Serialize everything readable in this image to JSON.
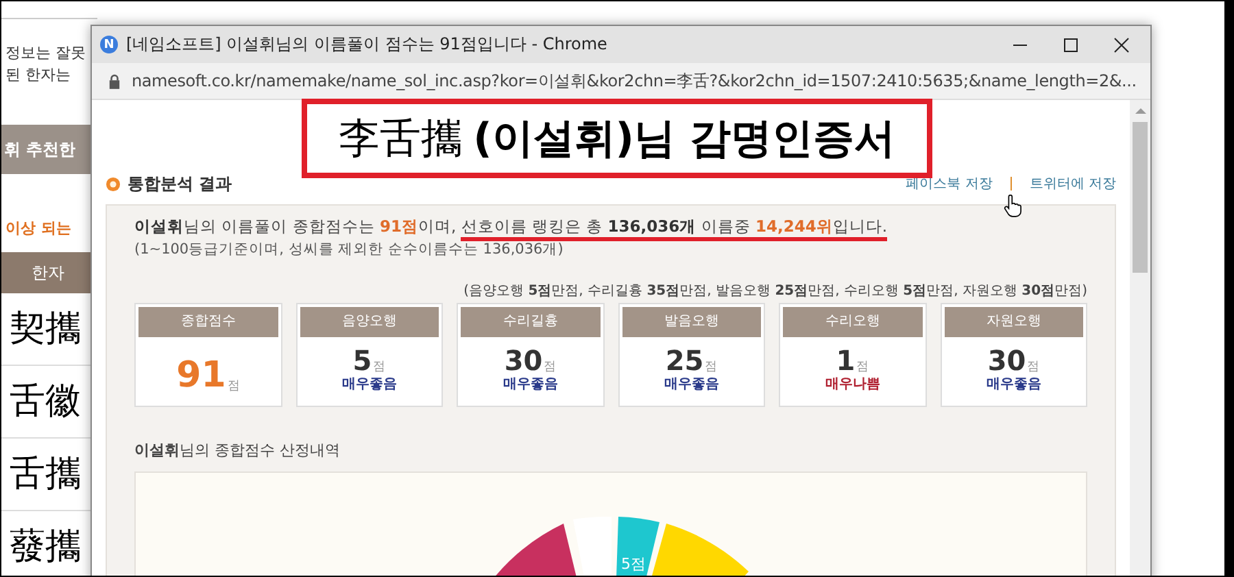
{
  "background_page": {
    "notes": [
      "정보는 잘못",
      "된 한자는"
    ],
    "tab_label": "휘 추천한",
    "warning": "이상 되는",
    "column_header": "한자",
    "hanja_rows": [
      "契攜",
      "舌徽",
      "舌攜",
      "蕟攜"
    ]
  },
  "window": {
    "favicon": "N",
    "title": "[네임소프트] 이설휘님의 이름풀이 점수는 91점입니다 - Chrome",
    "url": "namesoft.co.kr/namemake/name_sol_inc.asp?kor=이설휘&kor2chn=李舌?&kor2chn_id=1507:2410:5635;&name_length=2&..."
  },
  "certificate": {
    "hanja": "李舌攜",
    "title": "(이설휘)님 감명인증서"
  },
  "section_title": "통합분석 결과",
  "share_links": [
    "페이스북 저장",
    "트위터에 저장"
  ],
  "summary": [
    {
      "kind": "name",
      "text": "이설휘",
      "marked": false
    },
    {
      "kind": "plain",
      "text": "님의 이름풀이 종합점수는 ",
      "marked": false
    },
    {
      "kind": "accent",
      "text": "91점",
      "marked": false
    },
    {
      "kind": "plain",
      "text": "이며, ",
      "marked": false
    },
    {
      "kind": "plain",
      "text": "선호이름 랭킹은 총 ",
      "marked": true
    },
    {
      "kind": "name",
      "text": "136,036개",
      "marked": true
    },
    {
      "kind": "plain",
      "text": " 이름중 ",
      "marked": true
    },
    {
      "kind": "accent",
      "text": "14,244위",
      "marked": true
    },
    {
      "kind": "plain",
      "text": "입니다.",
      "marked": true
    }
  ],
  "summary_note": "(1~100등급기준이며, 성씨를 제외한 순수이름수는 136,036개)",
  "max_scores_note": "(음양오행 **5점**만점, 수리길흉 **35점**만점, 발음오행 **25점**만점, 수리오행 **5점**만점, 자원오행 **30점**만점)",
  "score_cards": [
    {
      "kind": "total",
      "title": "종합점수",
      "score": "91",
      "unit": "점"
    },
    {
      "kind": "good",
      "title": "음양오행",
      "score": "5",
      "unit": "점",
      "verdict": "매우좋음"
    },
    {
      "kind": "good",
      "title": "수리길흉",
      "score": "30",
      "unit": "점",
      "verdict": "매우좋음"
    },
    {
      "kind": "good",
      "title": "발음오행",
      "score": "25",
      "unit": "점",
      "verdict": "매우좋음"
    },
    {
      "kind": "bad",
      "title": "수리오행",
      "score": "1",
      "unit": "점",
      "verdict": "매우나쁨"
    },
    {
      "kind": "good",
      "title": "자원오행",
      "score": "30",
      "unit": "점",
      "verdict": "매우좋음"
    }
  ],
  "breakdown": {
    "name": "이설휘",
    "title": "님의 종합점수 산정내역",
    "pie_label": "5점"
  }
}
